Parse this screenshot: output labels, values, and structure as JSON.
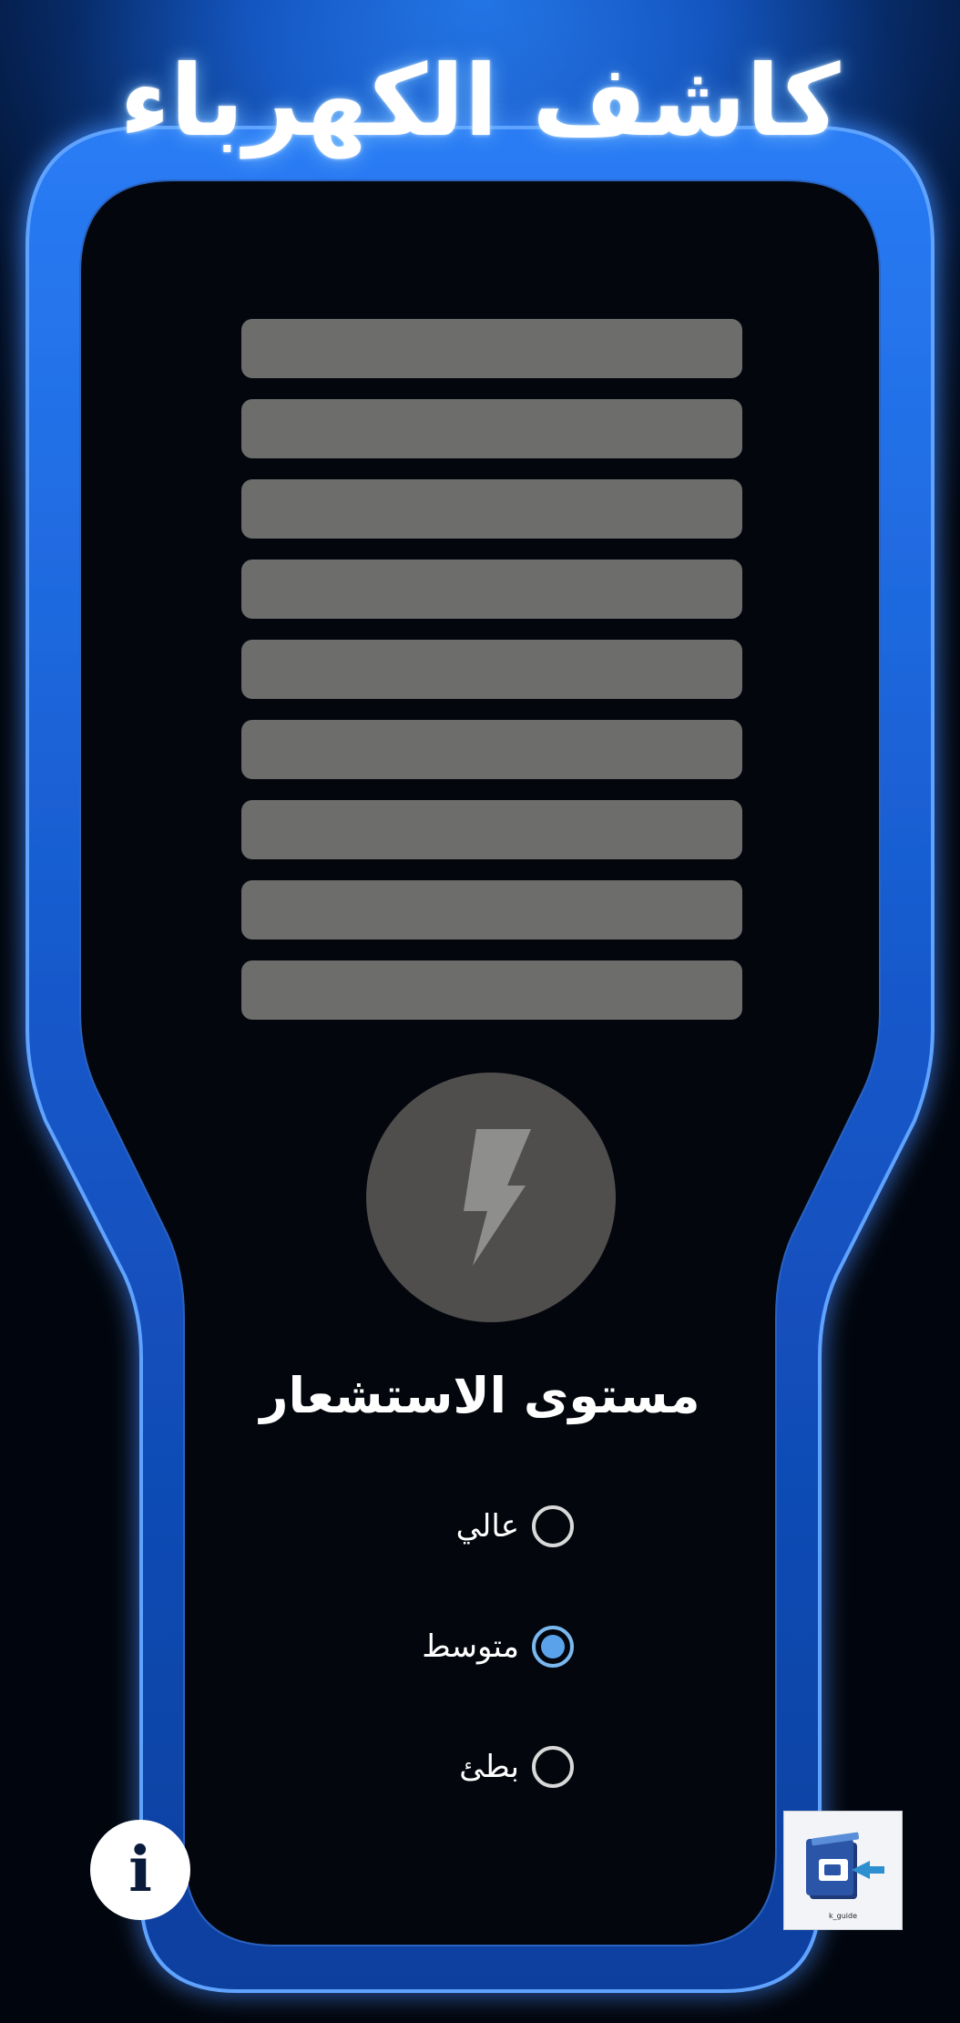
{
  "app": {
    "title": "كاشف الكهرباء"
  },
  "meter": {
    "bar_count": 9,
    "bar_color": "#6d6d6b",
    "active_level": 0
  },
  "power_button": {
    "icon": "lightning-bolt-icon"
  },
  "sensitivity": {
    "title": "مستوى الاستشعار",
    "options": [
      {
        "label": "عالي",
        "selected": false
      },
      {
        "label": "متوسط",
        "selected": true
      },
      {
        "label": "بطئ",
        "selected": false
      }
    ]
  },
  "info_button": {
    "icon": "info-icon",
    "label": "i"
  },
  "guide_button": {
    "icon": "guide-book-icon",
    "caption": "k_guide"
  },
  "colors": {
    "accent": "#1565e0",
    "frame_edge": "#4d92ff",
    "body": "#03060d",
    "radio_selected": "#5aa3ea"
  }
}
